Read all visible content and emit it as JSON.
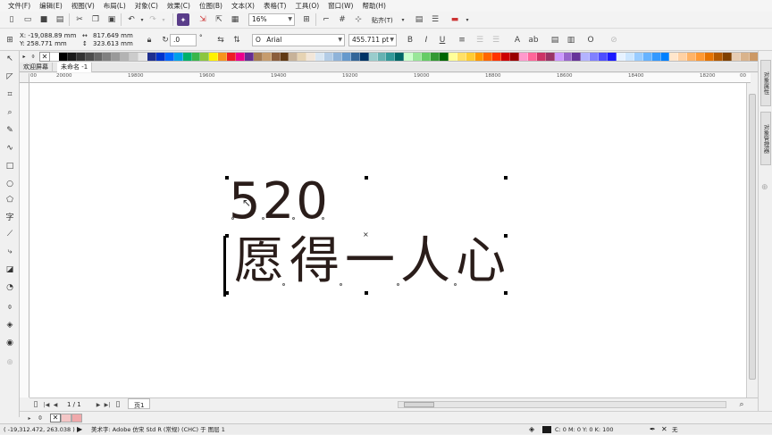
{
  "menubar": {
    "items": [
      "文件(F)",
      "编辑(E)",
      "视图(V)",
      "布局(L)",
      "对象(C)",
      "效果(C)",
      "位图(B)",
      "文本(X)",
      "表格(T)",
      "工具(O)",
      "窗口(W)",
      "帮助(H)"
    ]
  },
  "toolbar1": {
    "zoom": "16%",
    "snap_label": "贴齐(T)"
  },
  "toolbar2": {
    "x": "X: -19,088.89 mm",
    "y": "Y: 258.771 mm",
    "width": "817.649 mm",
    "height": "323.613 mm",
    "rotation": ".0",
    "degree": "°",
    "font_name": "Arial",
    "font_size": "455.711 pt"
  },
  "palette": {
    "colors": [
      "#ffffff",
      "#000000",
      "#1a1a1a",
      "#333333",
      "#4d4d4d",
      "#666666",
      "#808080",
      "#999999",
      "#b3b3b3",
      "#cccccc",
      "#e6e6e6",
      "#1f2f8f",
      "#0033cc",
      "#0066ff",
      "#00a0e9",
      "#00b16a",
      "#39b54a",
      "#8cc63f",
      "#fff200",
      "#f7941d",
      "#ed1c24",
      "#ec008c",
      "#662d91",
      "#a67c52",
      "#c69c6d",
      "#8b5e3c",
      "#603913",
      "#c7b299",
      "#e6d3b3",
      "#f2e6d9",
      "#d9e6f2",
      "#b3cce6",
      "#8fb3d9",
      "#6699cc",
      "#336699",
      "#003366",
      "#99cccc",
      "#66b2b2",
      "#339999",
      "#006666",
      "#ccffcc",
      "#99e699",
      "#66cc66",
      "#339933",
      "#006600",
      "#ffff99",
      "#ffe066",
      "#ffcc33",
      "#ff9900",
      "#ff6600",
      "#ff3300",
      "#cc0000",
      "#990000",
      "#ff99cc",
      "#ff6699",
      "#cc3366",
      "#993366",
      "#cc99ff",
      "#9966cc",
      "#663399",
      "#b3b3ff",
      "#8080ff",
      "#4d4dff",
      "#1a1aff",
      "#e6f2ff",
      "#cce6ff",
      "#99ccff",
      "#66b3ff",
      "#3399ff",
      "#0080ff",
      "#ffe6cc",
      "#ffd1a3",
      "#ffb366",
      "#ff9933",
      "#e67300",
      "#b35900",
      "#804000",
      "#e6ccb3",
      "#d9b38c",
      "#cc9966"
    ]
  },
  "doc_tabs": {
    "welcome": "欢迎屏幕",
    "doc": "未命名 -1"
  },
  "ruler": {
    "labels": [
      "20000",
      "19800",
      "19600",
      "19400",
      "19200",
      "19000",
      "18800",
      "18600",
      "18400",
      "18200"
    ],
    "edge_left": "00",
    "edge_right": "00"
  },
  "canvas": {
    "line1": "520",
    "line2": "愿得一人心"
  },
  "dockers": {
    "tab1": "对象属性",
    "tab2": "对象管理器"
  },
  "pagebar": {
    "page_count": "1 / 1",
    "page_tab": "页1"
  },
  "status": {
    "coords": "( -19,312.472, 263.038 )",
    "text_info": "美术字: Adobe 仿宋 Std R (常规) (CHC) 于 图层 1",
    "fill_info": "C: 0 M: 0 Y: 0 K: 100",
    "outline_info": "无"
  }
}
